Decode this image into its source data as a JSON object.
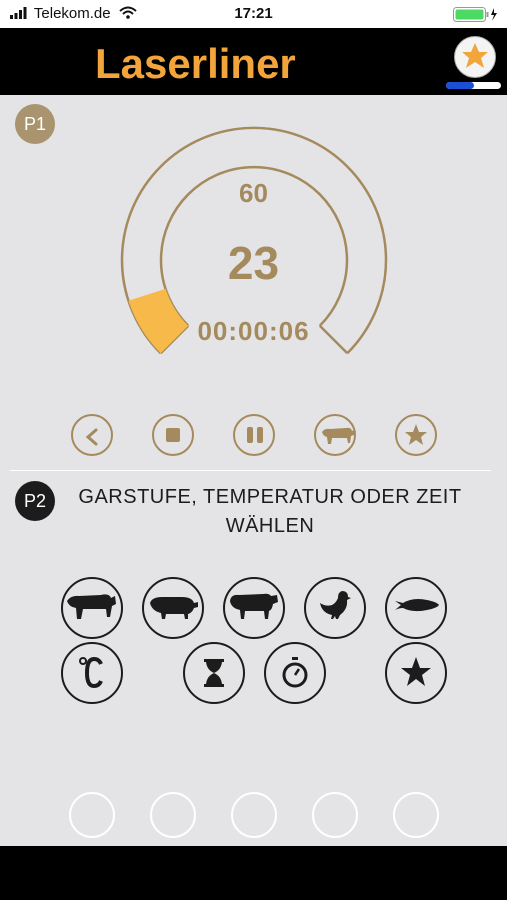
{
  "status_bar": {
    "carrier": "Telekom.de",
    "time": "17:21",
    "icons": [
      "signal-icon",
      "wifi-icon",
      "battery-icon",
      "charging-icon"
    ]
  },
  "header": {
    "brand": "Laserliner",
    "brand_color": "#f2a53a",
    "favorite_icon": "star-icon",
    "progress_fraction": 0.5
  },
  "p1": {
    "badge": "P1",
    "gauge": {
      "target": "60",
      "current": "23",
      "elapsed": "00:00:06",
      "fill_fraction": 0.1
    },
    "controls": [
      {
        "name": "back-button",
        "icon": "chevron-left-icon"
      },
      {
        "name": "stop-button",
        "icon": "stop-icon"
      },
      {
        "name": "pause-button",
        "icon": "pause-icon"
      },
      {
        "name": "meat-type-button",
        "icon": "cow-icon"
      },
      {
        "name": "favorite-button",
        "icon": "star-icon"
      }
    ],
    "accent_color": "#a48a5c",
    "fill_color": "#f6b94a"
  },
  "p2": {
    "badge": "P2",
    "prompt": "GARSTUFE, TEMPERATUR ODER ZEIT WÄHLEN",
    "options_row1": [
      "beef-icon",
      "pork-icon",
      "lamb-icon",
      "chicken-icon",
      "fish-icon"
    ],
    "options_row2": [
      "celsius-icon",
      "hourglass-icon",
      "stopwatch-icon",
      "star-icon"
    ]
  }
}
